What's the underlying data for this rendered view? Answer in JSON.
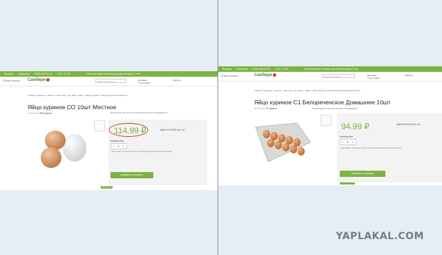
{
  "left": {
    "topbar": {
      "city": "Внуково",
      "metro": "Заборыво",
      "phone": "8-800-444-34-34",
      "hours": "9:00 - 21:00",
      "links": "Хлеб доставка   Оплата и доставка   Бонусы   О нас"
    },
    "header": {
      "logo": "Санбери",
      "catalog": "Весь каталог",
      "search_placeholder": "Поиск по каталогу",
      "delivery": "Доставка",
      "delivery_date": "с 12 октября",
      "cart": "Корзина"
    },
    "breadcrumb": "Главная страница  >  Каталог  >  Молочка, сыр, яйца  >  Яйцо  >  Яйцо куриное  >  Яйцо куриное СО Местное",
    "product": {
      "title": "Яйцо куриное СО 10шт Местное",
      "stars": "★★★★★",
      "reviews": "336 оценок",
      "producer": "Производитель: АО «Сельскохозяйственное предприятие»"
    },
    "buy": {
      "price": "114.99 ₽",
      "unit_price": "Цена 114.99 ₽ за 1 шт",
      "qty_label": "Количество",
      "qty_minus": "−",
      "qty_value": "1",
      "qty_plus": "+",
      "note": "* Цена может отличаться, срок и остаток определяются в момент покупки",
      "cart_button": "Добавить в корзину",
      "tag": "В наличии"
    }
  },
  "right": {
    "topbar": {
      "city": "Внуково",
      "metro": "Заборыво",
      "phone": "8-800-444-34-34",
      "hours": "9:00 - 21:00",
      "links": "Хлеб доставка   Оплата и доставка   Бонусы   О нас"
    },
    "header": {
      "logo": "Санбери",
      "catalog": "Весь каталог",
      "search_placeholder": "Поиск по каталогу",
      "delivery": "Доставка",
      "delivery_date": "с 12 октября",
      "cart": "Корзина"
    },
    "breadcrumb": "Главная страница  >  Каталог  >  Молочка, сыр, яйца  >  Яйцо  >  Яйцо куриное С1 Белореченское Домашнее 10шт",
    "product": {
      "title": "Яйцо куриное С1 Белореченское Домашнее 10шт",
      "stars": "★★★★★",
      "reviews": "12 оценок",
      "producer": "Производитель: Белореченская птицефабрика"
    },
    "buy": {
      "price": "94.99 ₽",
      "unit_price": "Цена 94.99 ₽ за 1 шт",
      "qty_label": "Количество",
      "qty_minus": "−",
      "qty_value": "1",
      "qty_plus": "+",
      "note": "* Цена может отличаться, срок и остаток определяются в момент покупки",
      "cart_button": "Добавить в корзину"
    }
  },
  "watermark": "YAPLAKAL.COM",
  "colors": {
    "accent_green": "#7cb342",
    "price_circle": "#d32f2f",
    "background": "#e6edf5"
  }
}
